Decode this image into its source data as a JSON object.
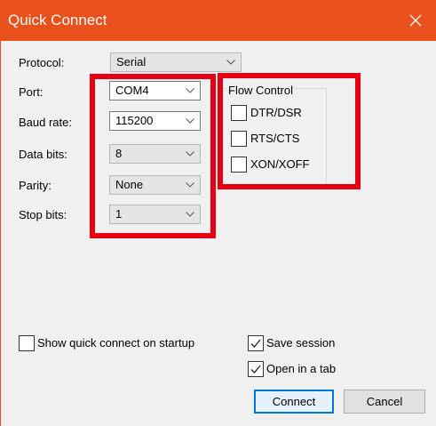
{
  "window": {
    "title": "Quick Connect"
  },
  "form": {
    "protocol": {
      "label": "Protocol:",
      "value": "Serial"
    },
    "port": {
      "label": "Port:",
      "value": "COM4"
    },
    "baud": {
      "label": "Baud rate:",
      "value": "115200"
    },
    "databits": {
      "label": "Data bits:",
      "value": "8"
    },
    "parity": {
      "label": "Parity:",
      "value": "None"
    },
    "stopbits": {
      "label": "Stop bits:",
      "value": "1"
    }
  },
  "flow_control": {
    "legend": "Flow Control",
    "options": [
      {
        "label": "DTR/DSR",
        "checked": false
      },
      {
        "label": "RTS/CTS",
        "checked": false
      },
      {
        "label": "XON/XOFF",
        "checked": false
      }
    ]
  },
  "options": {
    "show_on_startup": {
      "label": "Show quick connect on startup",
      "checked": false
    },
    "save_session": {
      "label": "Save session",
      "checked": true
    },
    "open_in_tab": {
      "label": "Open in a tab",
      "checked": true
    }
  },
  "buttons": {
    "connect": "Connect",
    "cancel": "Cancel"
  },
  "colors": {
    "titlebar": "#e9501c",
    "highlight": "#e60012",
    "default_button_border": "#0078d7"
  }
}
